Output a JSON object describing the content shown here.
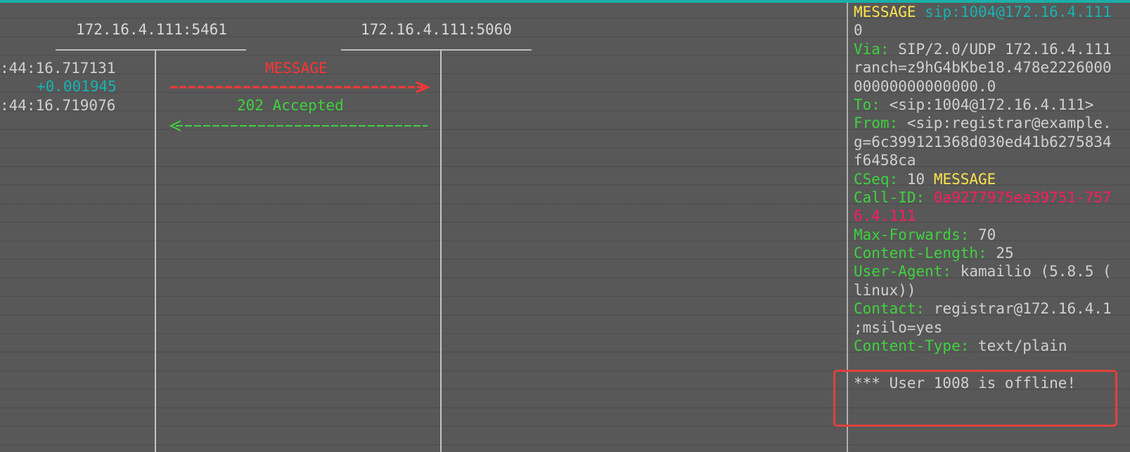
{
  "hosts": [
    "172.16.4.111:5461",
    "172.16.4.111:5060"
  ],
  "flow": [
    {
      "timestamp": ":44:16.717131",
      "delta": "+0.001945",
      "label": "MESSAGE",
      "direction": "right",
      "color": "#ff3535"
    },
    {
      "timestamp": ":44:16.719076",
      "label": "202 Accepted",
      "direction": "left",
      "color": "#3ed23e"
    }
  ],
  "detail": {
    "request_line": {
      "method": "MESSAGE",
      "uri": "sip:1004@172.16.4.111",
      "cont": "0"
    },
    "via": {
      "name": "Via:",
      "value": "SIP/2.0/UDP 172.16.4.111",
      "cont1": "ranch=z9hG4bKbe18.478e2226000",
      "cont2": "00000000000000.0"
    },
    "to": {
      "name": "To:",
      "value": "<sip:1004@172.16.4.111>"
    },
    "from": {
      "name": "From:",
      "value": "<sip:registrar@example.",
      "cont1": "g=6c399121368d030ed41b6275834",
      "cont2": "f6458ca"
    },
    "cseq": {
      "name": "CSeq:",
      "value": "10",
      "method": "MESSAGE"
    },
    "callid": {
      "name": "Call-ID:",
      "value": "0a9277975ea39751-757",
      "cont": "6.4.111"
    },
    "max_forwards": {
      "name": "Max-Forwards:",
      "value": "70"
    },
    "content_length": {
      "name": "Content-Length:",
      "value": "25"
    },
    "user_agent": {
      "name": "User-Agent:",
      "value": "kamailio (5.8.5 (",
      "cont": "linux))"
    },
    "contact": {
      "name": "Contact:",
      "value": "registrar@172.16.4.1",
      "cont": ";msilo=yes"
    },
    "content_type": {
      "name": "Content-Type:",
      "value": "text/plain"
    },
    "body": "*** User 1008 is offline!"
  },
  "colors": {
    "background": "#585858",
    "header_name": "#3ed23e",
    "method": "#ffe34a",
    "uri": "#17b2b2",
    "call_id": "#ff1a5e",
    "request_arrow": "#ff3535",
    "response_arrow": "#3ed23e",
    "highlight_box": "#e0413a",
    "top_bar": "#1ab0a8"
  }
}
